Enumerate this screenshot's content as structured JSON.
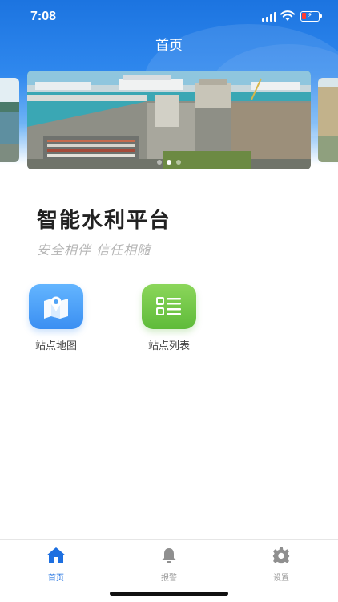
{
  "status_bar": {
    "time": "7:08"
  },
  "nav": {
    "title": "首页"
  },
  "banner": {
    "slide_count": 3,
    "active_index": 1
  },
  "app": {
    "title": "智能水利平台",
    "slogan": "安全相伴 信任相随"
  },
  "features": [
    {
      "label": "站点地图",
      "icon": "map-pin-icon",
      "color": "#4ea3f7"
    },
    {
      "label": "站点列表",
      "icon": "list-icon",
      "color": "#71c74a"
    }
  ],
  "tabbar": {
    "items": [
      {
        "label": "首页",
        "icon": "home-icon",
        "active": true
      },
      {
        "label": "报警",
        "icon": "bell-icon",
        "active": false
      },
      {
        "label": "设置",
        "icon": "gear-icon",
        "active": false
      }
    ],
    "active_color": "#1d6fe0",
    "inactive_color": "#999999"
  }
}
